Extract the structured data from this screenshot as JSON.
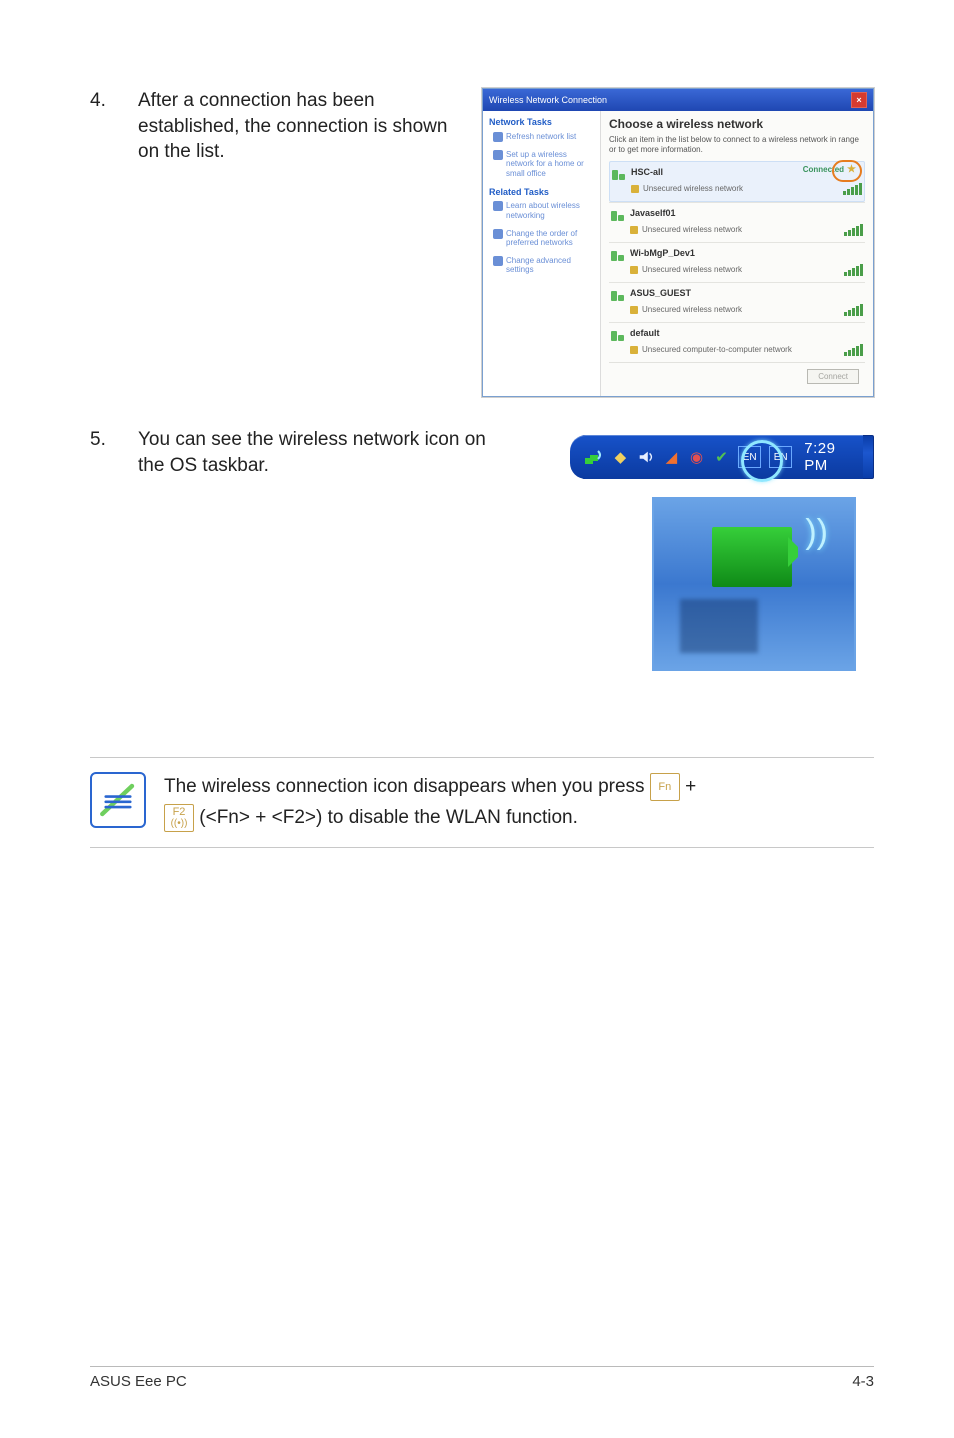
{
  "step4": {
    "num": "4.",
    "text": "After a connection has been established, the connection is shown on the list.",
    "dialog": {
      "title": "Wireless Network Connection",
      "leftHeader1": "Network Tasks",
      "task1": "Refresh network list",
      "task2": "Set up a wireless network for a home or small office",
      "leftHeader2": "Related Tasks",
      "task3": "Learn about wireless networking",
      "task4": "Change the order of preferred networks",
      "task5": "Change advanced settings",
      "rightHeader": "Choose a wireless network",
      "rightSub": "Click an item in the list below to connect to a wireless network in range or to get more information.",
      "statusLabel": "Connected",
      "securedLabel": "Unsecured wireless network",
      "unsecuredCompLabel": "Unsecured computer-to-computer network",
      "networks": [
        {
          "name": "HSC-all",
          "sec": "Unsecured wireless network",
          "connected": true
        },
        {
          "name": "Javaself01",
          "sec": "Unsecured wireless network"
        },
        {
          "name": "Wi-bMgP_Dev1",
          "sec": "Unsecured wireless network"
        },
        {
          "name": "ASUS_GUEST",
          "sec": "Unsecured wireless network"
        },
        {
          "name": "default",
          "sec": "Unsecured computer-to-computer network"
        }
      ],
      "connectBtn": "Connect"
    }
  },
  "step5": {
    "num": "5.",
    "text": "You can see the wireless network icon on the OS taskbar.",
    "clock": "7:29 PM"
  },
  "note": {
    "line1a": "The wireless connection icon disappears when you press ",
    "line1b": " + ",
    "line2a": " (<Fn> + <F2>) to disable the WLAN function.",
    "keyFn": "Fn",
    "keyF2": "F2"
  },
  "footer": {
    "left": "ASUS Eee PC",
    "right": "4-3"
  }
}
